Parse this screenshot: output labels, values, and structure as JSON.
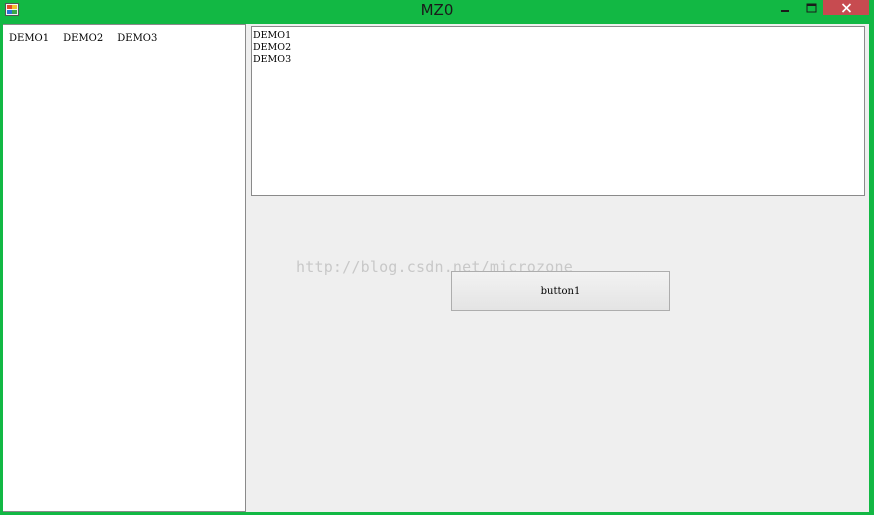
{
  "window": {
    "title": "MZ0",
    "accent_color": "#12b844",
    "close_color": "#c74b50"
  },
  "left_panel": {
    "items": [
      {
        "label": "DEMO1"
      },
      {
        "label": "DEMO2"
      },
      {
        "label": "DEMO3"
      }
    ]
  },
  "textbox": {
    "lines": [
      "DEMO1",
      "DEMO2",
      "DEMO3"
    ]
  },
  "watermark": "http://blog.csdn.net/microzone",
  "button1": {
    "label": "button1"
  }
}
